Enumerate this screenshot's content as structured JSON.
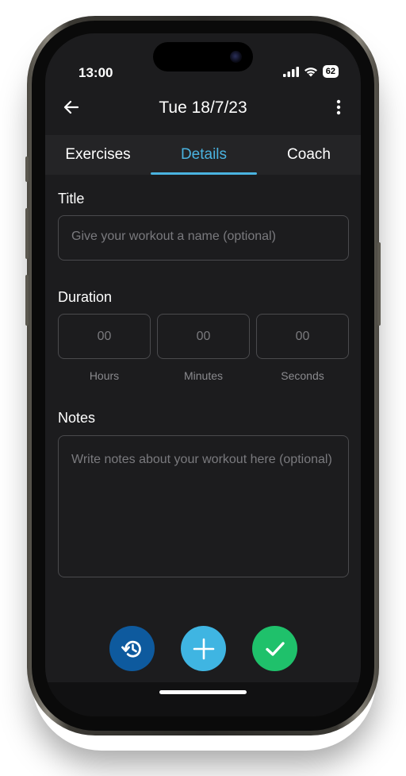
{
  "status_bar": {
    "time": "13:00",
    "battery": "62"
  },
  "header": {
    "title": "Tue 18/7/23"
  },
  "tabs": [
    {
      "label": "Exercises",
      "active": false
    },
    {
      "label": "Details",
      "active": true
    },
    {
      "label": "Coach",
      "active": false
    }
  ],
  "title_section": {
    "label": "Title",
    "placeholder": "Give your workout a name (optional)"
  },
  "duration": {
    "label": "Duration",
    "fields": [
      {
        "value": "00",
        "caption": "Hours"
      },
      {
        "value": "00",
        "caption": "Minutes"
      },
      {
        "value": "00",
        "caption": "Seconds"
      }
    ]
  },
  "notes": {
    "label": "Notes",
    "placeholder": "Write notes about your workout here (optional)"
  },
  "colors": {
    "accent": "#4ab3e0",
    "history_button": "#0e5a9e",
    "add_button": "#3fb5e2",
    "confirm_button": "#1fc16b",
    "background": "#1c1c1e"
  },
  "icons": {
    "back": "arrow-left-icon",
    "more": "more-vertical-icon",
    "history": "history-icon",
    "add": "plus-icon",
    "confirm": "check-icon"
  }
}
